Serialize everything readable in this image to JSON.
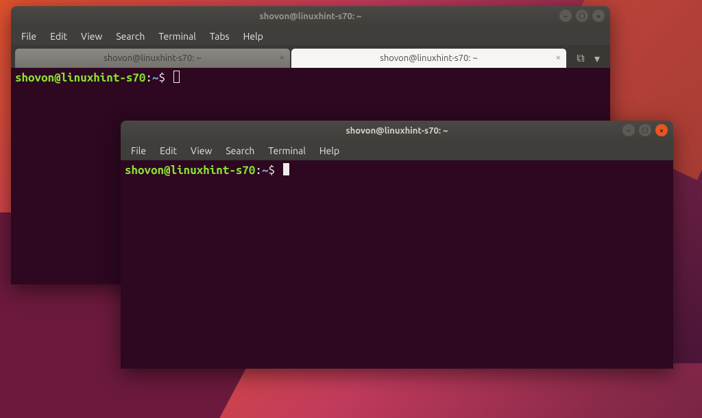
{
  "windows": {
    "back": {
      "title": "shovon@linuxhint-s70: ~",
      "menus": [
        "File",
        "Edit",
        "View",
        "Search",
        "Terminal",
        "Tabs",
        "Help"
      ],
      "tabs": [
        {
          "label": "shovon@linuxhint-s70: ~",
          "active": true
        },
        {
          "label": "shovon@linuxhint-s70: ~",
          "active": false
        }
      ],
      "prompt": {
        "user_host": "shovon@linuxhint-s70",
        "path": "~",
        "symbol": "$"
      },
      "controls": {
        "minimize": "–",
        "maximize": "▢",
        "close": "×"
      },
      "new_tab_glyph": "⧉",
      "dropdown_glyph": "▾"
    },
    "front": {
      "title": "shovon@linuxhint-s70: ~",
      "menus": [
        "File",
        "Edit",
        "View",
        "Search",
        "Terminal",
        "Help"
      ],
      "prompt": {
        "user_host": "shovon@linuxhint-s70",
        "path": "~",
        "symbol": "$"
      },
      "controls": {
        "minimize": "–",
        "maximize": "▢",
        "close": "×"
      }
    }
  }
}
